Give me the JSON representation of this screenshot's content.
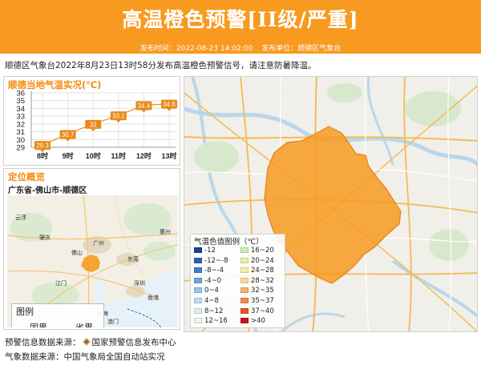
{
  "header": {
    "title": "高温橙色预警[II级/严重]",
    "publish_time": "发布时间：2022-08-23 14:02:00",
    "publisher": "发布单位：顺德区气象台"
  },
  "notice": "顺德区气象台2022年8月23日13时58分发布高温橙色预警信号，请注意防暑降温。",
  "temperature": {
    "panel_title": "顺德当地气温实况(℃)"
  },
  "chart_data": {
    "type": "line",
    "title": "顺德当地气温实况(℃)",
    "categories": [
      "8时",
      "9时",
      "10时",
      "11时",
      "12时",
      "13时"
    ],
    "values": [
      29.3,
      30.7,
      32,
      33.1,
      34.4,
      34.6
    ],
    "ylim": [
      29,
      36
    ],
    "yticks": [
      "29",
      "30",
      "31",
      "32",
      "33",
      "34",
      "35",
      "36"
    ],
    "grid": true,
    "colors": {
      "line": "#f58a0e",
      "label_bg": "#e9891a"
    }
  },
  "location": {
    "panel_title": "定位概览",
    "name": "广东省-佛山市-顺德区",
    "legend": {
      "title": "图例",
      "items": [
        {
          "label": "国界",
          "color": "#d25b7a"
        },
        {
          "label": "省界",
          "color": "#2f64c2"
        }
      ]
    },
    "place_labels": {
      "guangzhou": "广州",
      "foshan": "佛山",
      "dongguan": "东莞",
      "huizhou": "惠州",
      "shenzhen": "深圳",
      "zhuhai": "珠海",
      "hongkong": "香港",
      "jiangmen": "江门",
      "aomen": "澳门",
      "yunfu": "云浮",
      "zhaoqing": "肇庆"
    }
  },
  "temp_legend": {
    "title": "气温色值图例（℃）",
    "items": [
      {
        "label": "-12",
        "color": "#1b3f95"
      },
      {
        "label": "16~20",
        "color": "#c9f1b3"
      },
      {
        "label": "-12~-8",
        "color": "#2c5fb8"
      },
      {
        "label": "20~24",
        "color": "#e4f2a3"
      },
      {
        "label": "-8~-4",
        "color": "#3d7fd0"
      },
      {
        "label": "24~28",
        "color": "#f5eea4"
      },
      {
        "label": "-4~0",
        "color": "#6aa6e0"
      },
      {
        "label": "28~32",
        "color": "#f7d994"
      },
      {
        "label": "0~4",
        "color": "#98c6ec"
      },
      {
        "label": "32~35",
        "color": "#f5b06d"
      },
      {
        "label": "4~8",
        "color": "#bcdcf2"
      },
      {
        "label": "35~37",
        "color": "#f28a45"
      },
      {
        "label": "8~12",
        "color": "#daeef8"
      },
      {
        "label": "37~40",
        "color": "#e8542a"
      },
      {
        "label": "12~16",
        "color": "#e9f7ee"
      },
      {
        "label": ">40",
        "color": "#c8121b"
      }
    ]
  },
  "footer": {
    "warning_source_label": "预警信息数据来源：",
    "warning_source_name": "国家预警信息发布中心",
    "weather_source": "气象数据来源：中国气象局全国自动站实况"
  }
}
